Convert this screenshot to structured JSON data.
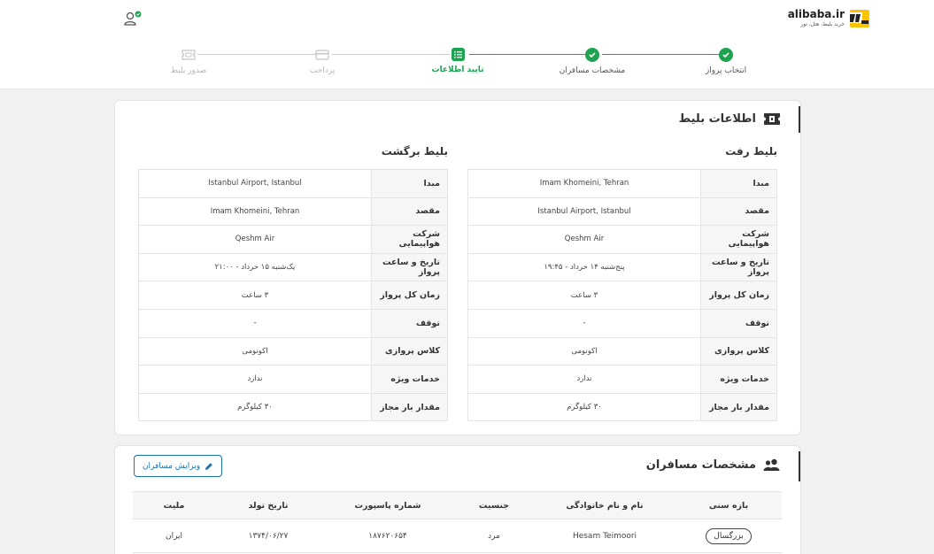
{
  "brand": {
    "name": "alibaba.ir",
    "tagline": "خرید بلیط، هتل، تور"
  },
  "colors": {
    "accent": "#1ea351",
    "link": "#1a6fb0"
  },
  "steps": [
    {
      "label": "انتخاب پرواز",
      "state": "done"
    },
    {
      "label": "مشخصات مسافران",
      "state": "done"
    },
    {
      "label": "تایید اطلاعات",
      "state": "active"
    },
    {
      "label": "پرداخت",
      "state": "todo"
    },
    {
      "label": "صدور بلیط",
      "state": "todo"
    }
  ],
  "ticket_info": {
    "title": "اطلاعات بلیط",
    "outbound": {
      "title": "بلیط رفت",
      "rows": [
        {
          "k": "مبدا",
          "v": "Imam Khomeini, Tehran"
        },
        {
          "k": "مقصد",
          "v": "Istanbul Airport, Istanbul"
        },
        {
          "k": "شرکت هواپیمایی",
          "v": "Qeshm Air"
        },
        {
          "k": "تاریخ و ساعت پرواز",
          "v": "پنج‌شنبه ۱۴ خرداد - ۱۹:۴۵"
        },
        {
          "k": "زمان کل پرواز",
          "v": "۳ ساعت"
        },
        {
          "k": "توقف",
          "v": "-"
        },
        {
          "k": "کلاس پروازی",
          "v": "اکونومی"
        },
        {
          "k": "خدمات ویژه",
          "v": "ندارد"
        },
        {
          "k": "مقدار بار مجاز",
          "v": "۳۰ کیلوگرم"
        }
      ]
    },
    "return": {
      "title": "بلیط برگشت",
      "rows": [
        {
          "k": "مبدا",
          "v": "Istanbul Airport, Istanbul"
        },
        {
          "k": "مقصد",
          "v": "Imam Khomeini, Tehran"
        },
        {
          "k": "شرکت هواپیمایی",
          "v": "Qeshm Air"
        },
        {
          "k": "تاریخ و ساعت پرواز",
          "v": "یک‌شنبه ۱۵ خرداد - ۲۱:۰۰"
        },
        {
          "k": "زمان کل پرواز",
          "v": "۳ ساعت"
        },
        {
          "k": "توقف",
          "v": "-"
        },
        {
          "k": "کلاس پروازی",
          "v": "اکونومی"
        },
        {
          "k": "خدمات ویژه",
          "v": "ندارد"
        },
        {
          "k": "مقدار بار مجاز",
          "v": "۳۰ کیلوگرم"
        }
      ]
    }
  },
  "passengers": {
    "title": "مشخصات مسافران",
    "edit_label": "ویرایش مسافران",
    "columns": [
      "بازه سنی",
      "نام و نام خانوادگی",
      "جنسیت",
      "شماره پاسپورت",
      "تاریخ تولد",
      "ملیت"
    ],
    "rows": [
      {
        "age": "بزرگسال",
        "name": "Hesam Teimoori",
        "gender": "مرد",
        "passport": "۱۸۷۶۲۰۶۵۴",
        "dob": "۱۳۷۴/۰۶/۲۷",
        "nationality": "ایران"
      }
    ]
  }
}
